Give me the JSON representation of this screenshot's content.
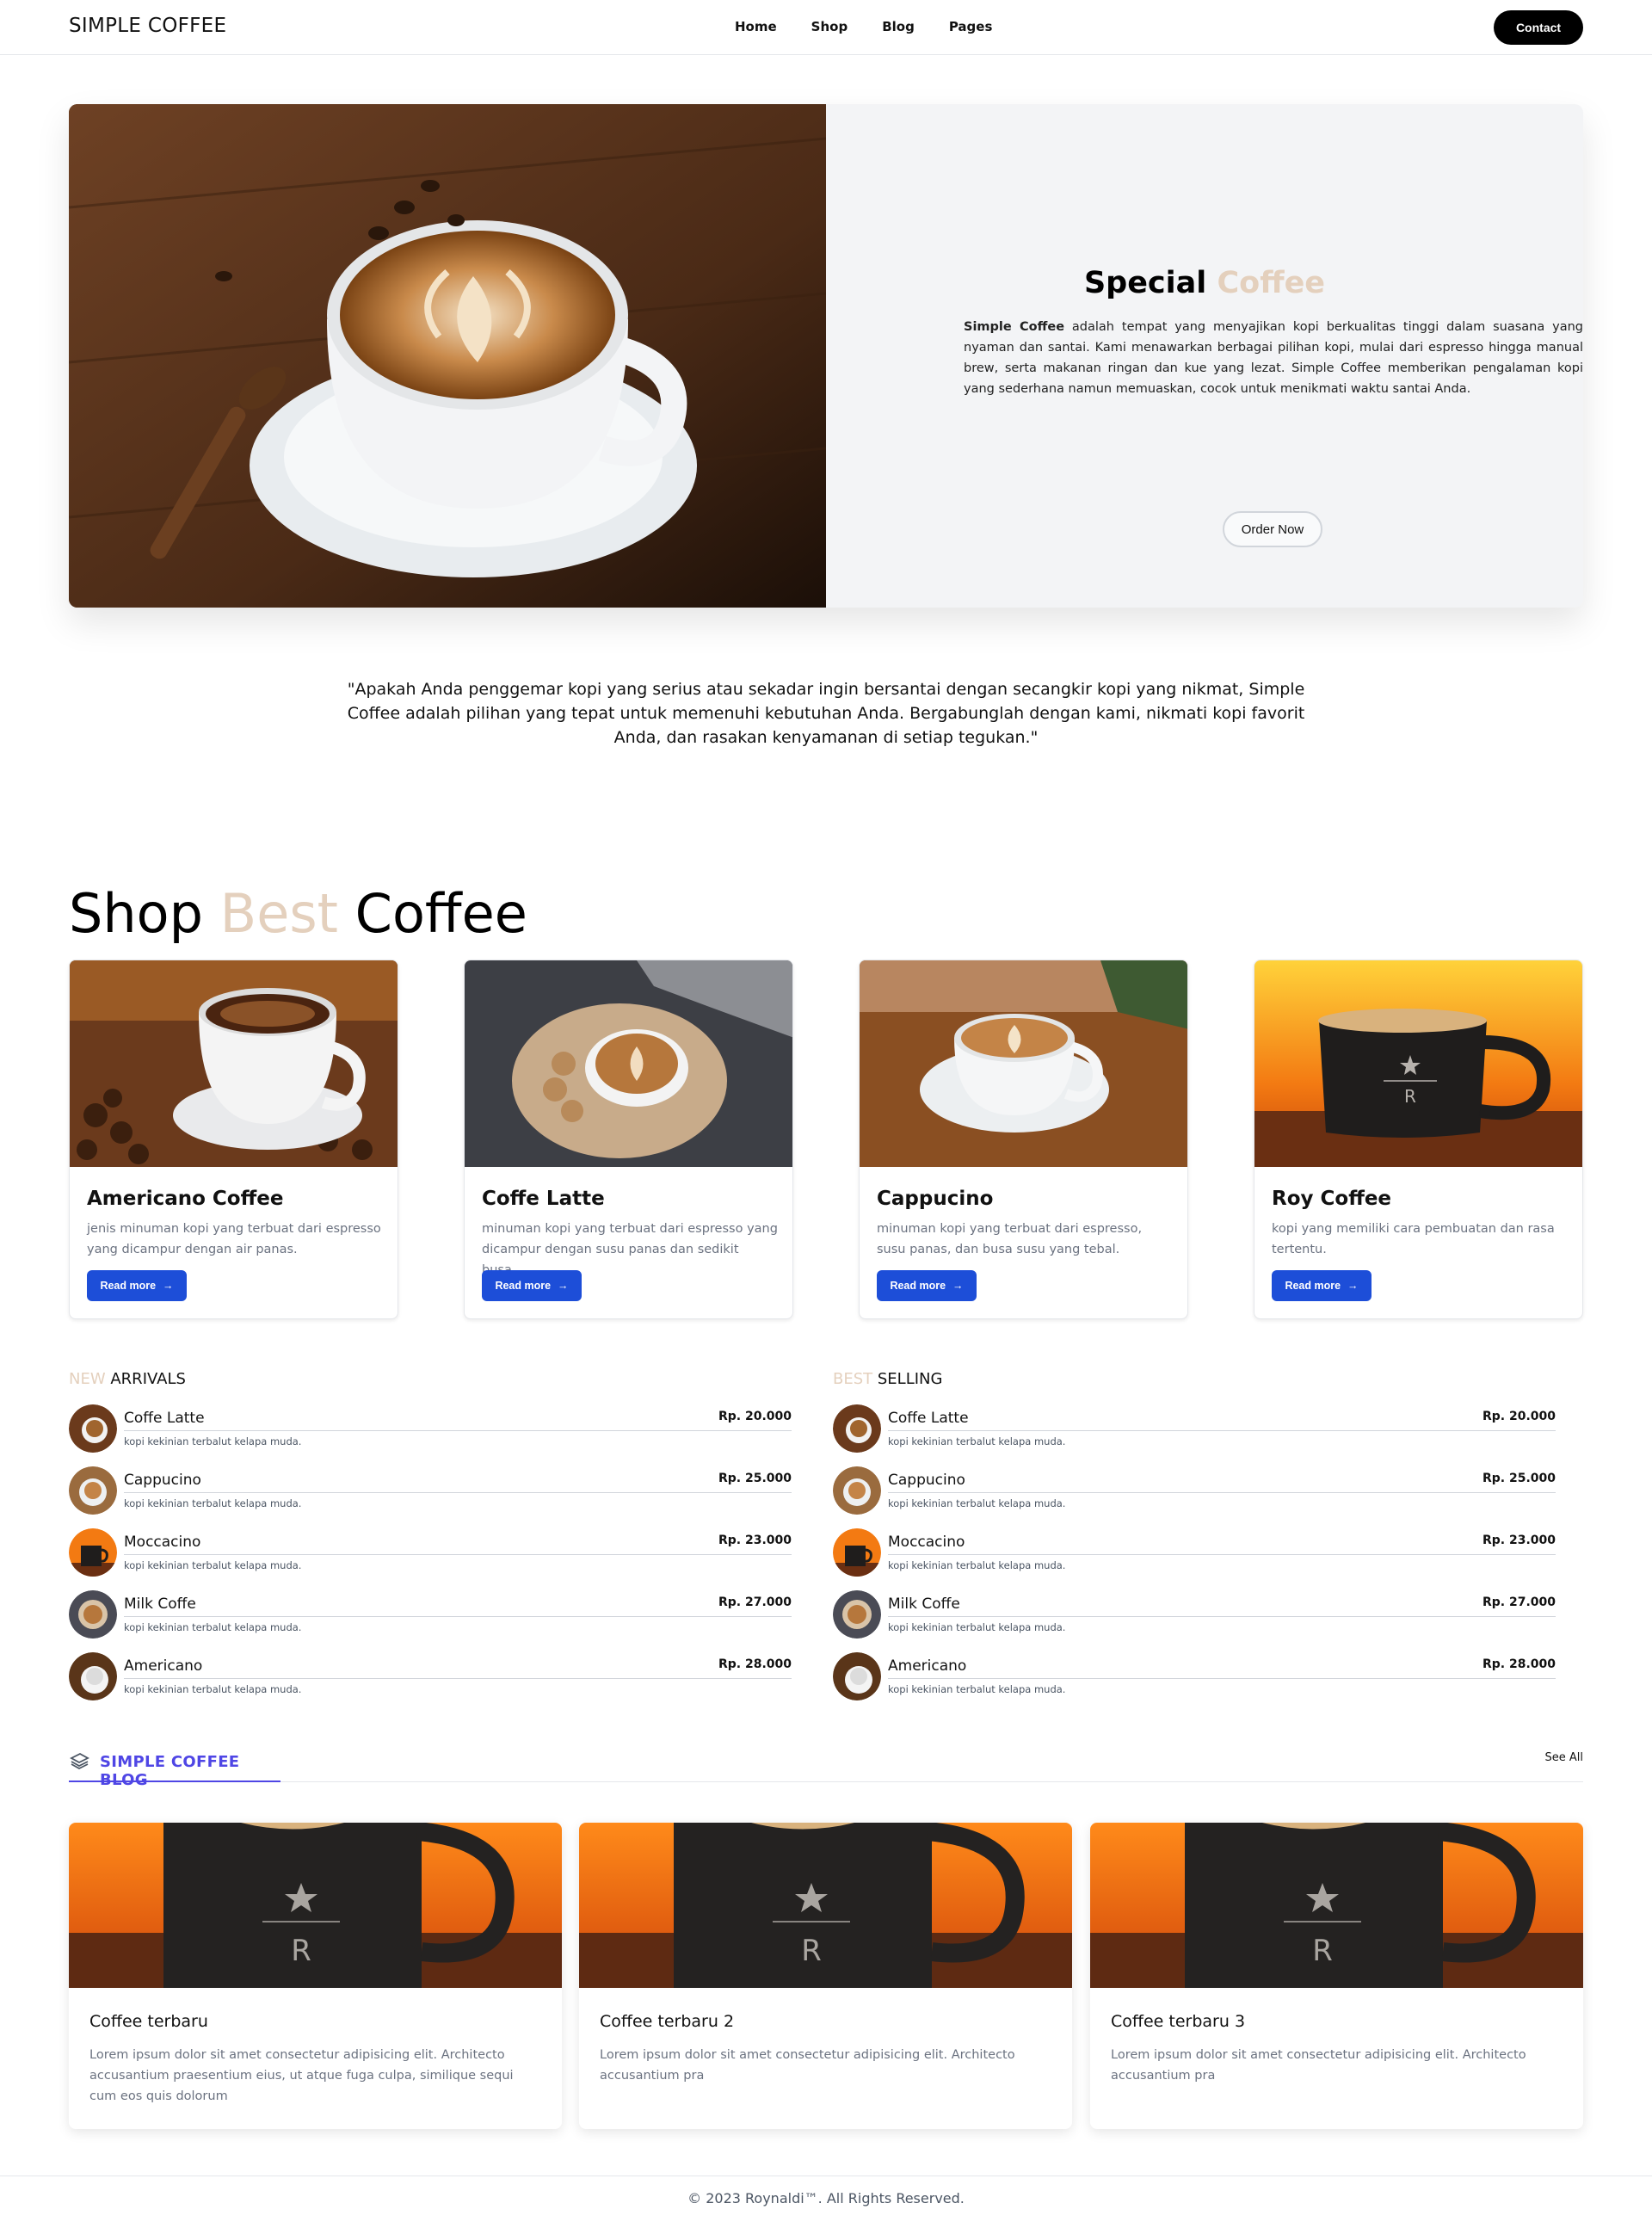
{
  "nav": {
    "brand": "SIMPLE COFFEE",
    "links": [
      "Home",
      "Shop",
      "Blog",
      "Pages"
    ],
    "contact_label": "Contact"
  },
  "hero": {
    "title_main": "Special ",
    "title_accent": "Coffee",
    "desc_bold": "Simple Coffee",
    "desc_rest": " adalah tempat yang menyajikan kopi berkualitas tinggi dalam suasana yang nyaman dan santai. Kami menawarkan berbagai pilihan kopi, mulai dari espresso hingga manual brew, serta makanan ringan dan kue yang lezat. Simple Coffee memberikan pengalaman kopi yang sederhana namun memuaskan, cocok untuk menikmati waktu santai Anda.",
    "order_label": "Order Now"
  },
  "quote": "\"Apakah Anda penggemar kopi yang serius atau sekadar ingin bersantai dengan secangkir kopi yang nikmat, Simple Coffee adalah pilihan yang tepat untuk memenuhi kebutuhan Anda. Bergabunglah dengan kami, nikmati kopi favorit Anda, dan rasakan kenyamanan di setiap tegukan.\"",
  "shop": {
    "title_a": "Shop ",
    "title_accent": "Best",
    "title_b": " Coffee",
    "read_more_label": "Read more",
    "cards": [
      {
        "title": "Americano Coffee",
        "text": "jenis minuman kopi yang terbuat dari espresso yang dicampur dengan air panas."
      },
      {
        "title": "Coffe Latte",
        "text": "minuman kopi yang terbuat dari espresso yang dicampur dengan susu panas dan sedikit busa..."
      },
      {
        "title": "Cappucino",
        "text": "minuman kopi yang terbuat dari espresso, susu panas, dan busa susu yang tebal."
      },
      {
        "title": "Roy Coffee",
        "text": "kopi yang memiliki cara pembuatan dan rasa tertentu."
      }
    ]
  },
  "new_arrivals": {
    "title_accent": "NEW",
    "title_rest": " ARRIVALS",
    "items": [
      {
        "name": "Coffe Latte",
        "price": "Rp. 20.000",
        "desc": "kopi kekinian terbalut kelapa muda."
      },
      {
        "name": "Cappucino",
        "price": "Rp. 25.000",
        "desc": "kopi kekinian terbalut kelapa muda."
      },
      {
        "name": "Moccacino",
        "price": "Rp. 23.000",
        "desc": "kopi kekinian terbalut kelapa muda."
      },
      {
        "name": "Milk Coffe",
        "price": "Rp. 27.000",
        "desc": "kopi kekinian terbalut kelapa muda."
      },
      {
        "name": "Americano",
        "price": "Rp. 28.000",
        "desc": "kopi kekinian terbalut kelapa muda."
      }
    ]
  },
  "best_selling": {
    "title_accent": "BEST",
    "title_rest": " SELLING",
    "items": [
      {
        "name": "Coffe Latte",
        "price": "Rp. 20.000",
        "desc": "kopi kekinian terbalut kelapa muda."
      },
      {
        "name": "Cappucino",
        "price": "Rp. 25.000",
        "desc": "kopi kekinian terbalut kelapa muda."
      },
      {
        "name": "Moccacino",
        "price": "Rp. 23.000",
        "desc": "kopi kekinian terbalut kelapa muda."
      },
      {
        "name": "Milk Coffe",
        "price": "Rp. 27.000",
        "desc": "kopi kekinian terbalut kelapa muda."
      },
      {
        "name": "Americano",
        "price": "Rp. 28.000",
        "desc": "kopi kekinian terbalut kelapa muda."
      }
    ]
  },
  "blog": {
    "tab_label": "SIMPLE COFFEE BLOG",
    "see_all_label": "See All",
    "cards": [
      {
        "title": "Coffee terbaru",
        "text": "Lorem ipsum dolor sit amet consectetur adipisicing elit. Architecto accusantium praesentium eius, ut atque fuga culpa, similique sequi cum eos quis dolorum"
      },
      {
        "title": "Coffee terbaru 2",
        "text": "Lorem ipsum dolor sit amet consectetur adipisicing elit. Architecto accusantium pra"
      },
      {
        "title": "Coffee terbaru 3",
        "text": "Lorem ipsum dolor sit amet consectetur adipisicing elit. Architecto accusantium pra"
      }
    ]
  },
  "footer": "© 2023 Roynaldi™. All Rights Reserved.",
  "colors": {
    "accent": "#e4d0bd",
    "primary_button": "#1d4ed8",
    "blog_accent": "#4f46e5"
  },
  "icons": [
    "arrow-right-icon",
    "newspaper-icon"
  ]
}
